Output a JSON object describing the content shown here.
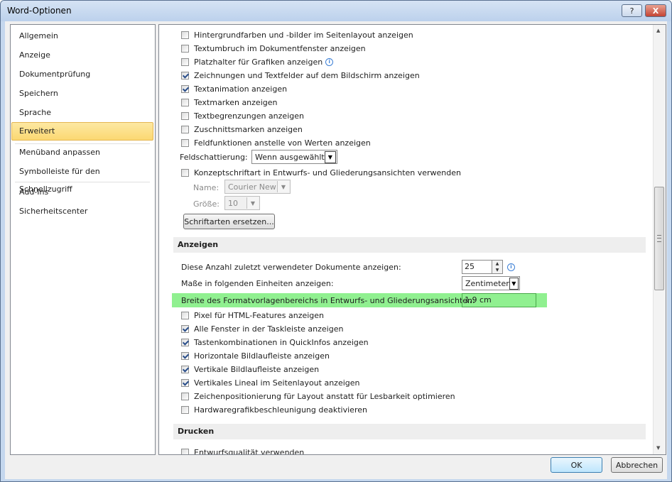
{
  "window": {
    "title": "Word-Optionen",
    "help_label": "?",
    "close_label": "X"
  },
  "sidebar": {
    "items": [
      {
        "label": "Allgemein"
      },
      {
        "label": "Anzeige"
      },
      {
        "label": "Dokumentprüfung"
      },
      {
        "label": "Speichern"
      },
      {
        "label": "Sprache"
      },
      {
        "label": "Erweitert",
        "selected": true
      },
      {
        "label": "Menüband anpassen"
      },
      {
        "label": "Symbolleiste für den Schnellzugriff"
      },
      {
        "label": "Add-Ins"
      },
      {
        "label": "Sicherheitscenter"
      }
    ]
  },
  "content": {
    "top_checks": [
      {
        "label": "Hintergrundfarben und -bilder im Seitenlayout anzeigen",
        "checked": false
      },
      {
        "label": "Textumbruch im Dokumentfenster anzeigen",
        "checked": false
      },
      {
        "label": "Platzhalter für Grafiken anzeigen",
        "checked": false,
        "info": true
      },
      {
        "label": "Zeichnungen und Textfelder auf dem Bildschirm anzeigen",
        "checked": true
      },
      {
        "label": "Textanimation anzeigen",
        "checked": true
      },
      {
        "label": "Textmarken anzeigen",
        "checked": false
      },
      {
        "label": "Textbegrenzungen anzeigen",
        "checked": false
      },
      {
        "label": "Zuschnittsmarken anzeigen",
        "checked": false
      },
      {
        "label": "Feldfunktionen anstelle von Werten anzeigen",
        "checked": false
      }
    ],
    "field_shading": {
      "label": "Feldschattierung:",
      "value": "Wenn ausgewählt"
    },
    "draft_font": {
      "label": "Konzeptschriftart in Entwurfs- und Gliederungsansichten verwenden",
      "checked": false
    },
    "font_name": {
      "label": "Name:",
      "value": "Courier New"
    },
    "font_size": {
      "label": "Größe:",
      "value": "10"
    },
    "replace_fonts_button": "Schriftarten ersetzen...",
    "display_section": {
      "title": "Anzeigen",
      "recent_docs": {
        "label": "Diese Anzahl zuletzt verwendeter Dokumente anzeigen:",
        "value": "25"
      },
      "units": {
        "label": "Maße in folgenden Einheiten anzeigen:",
        "value": "Zentimeter"
      },
      "style_area": {
        "label": "Breite des Formatvorlagenbereichs in Entwurfs- und Gliederungsansichten:",
        "value": "1,9 cm"
      },
      "checks": [
        {
          "label": "Pixel für HTML-Features anzeigen",
          "checked": false
        },
        {
          "label": "Alle Fenster in der Taskleiste anzeigen",
          "checked": true
        },
        {
          "label": "Tastenkombinationen in QuickInfos anzeigen",
          "checked": true
        },
        {
          "label": "Horizontale Bildlaufleiste anzeigen",
          "checked": true
        },
        {
          "label": "Vertikale Bildlaufleiste anzeigen",
          "checked": true
        },
        {
          "label": "Vertikales Lineal im Seitenlayout anzeigen",
          "checked": true
        },
        {
          "label": "Zeichenpositionierung für Layout anstatt für Lesbarkeit optimieren",
          "checked": false
        },
        {
          "label": "Hardwaregrafikbeschleunigung deaktivieren",
          "checked": false
        }
      ]
    },
    "print_section": {
      "title": "Drucken",
      "checks": [
        {
          "label": "Entwurfsqualität verwenden",
          "checked": false
        }
      ]
    }
  },
  "footer": {
    "ok_label": "OK",
    "cancel_label": "Abbrechen"
  },
  "colors": {
    "highlight": "#90f090",
    "selection": "#fbd872"
  }
}
